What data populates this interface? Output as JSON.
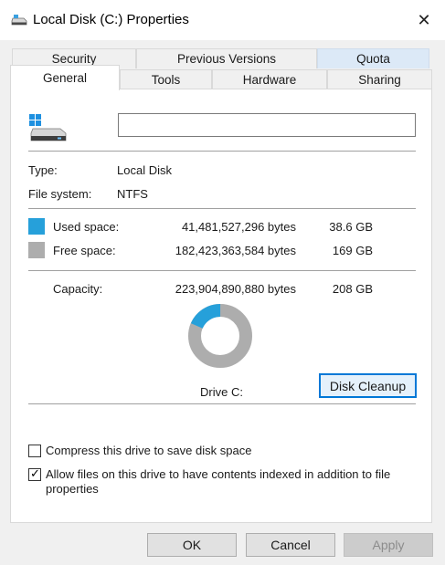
{
  "window": {
    "title": "Local Disk (C:) Properties",
    "close_glyph": "✕"
  },
  "tabs": {
    "top_row": [
      {
        "label": "Security"
      },
      {
        "label": "Previous Versions"
      },
      {
        "label": "Quota"
      }
    ],
    "bottom_row": [
      {
        "label": "General",
        "active": true
      },
      {
        "label": "Tools"
      },
      {
        "label": "Hardware"
      },
      {
        "label": "Sharing"
      }
    ]
  },
  "general": {
    "name_value": "",
    "type_label": "Type:",
    "type_value": "Local Disk",
    "fs_label": "File system:",
    "fs_value": "NTFS",
    "used": {
      "label": "Used space:",
      "bytes": "41,481,527,296 bytes",
      "size": "38.6 GB",
      "color": "#26a0da"
    },
    "free": {
      "label": "Free space:",
      "bytes": "182,423,363,584 bytes",
      "size": "169 GB",
      "color": "#adadad"
    },
    "capacity": {
      "label": "Capacity:",
      "bytes": "223,904,890,880 bytes",
      "size": "208 GB"
    },
    "used_fraction": 0.1853,
    "drive_label": "Drive C:",
    "cleanup_label": "Disk Cleanup",
    "compress_label": "Compress this drive to save disk space",
    "compress_checked": false,
    "index_label": "Allow files on this drive to have contents indexed in addition to file properties",
    "index_checked": true
  },
  "buttons": {
    "ok": "OK",
    "cancel": "Cancel",
    "apply": "Apply"
  },
  "colors": {
    "accent": "#0078d7",
    "used": "#26a0da",
    "free": "#adadad"
  }
}
